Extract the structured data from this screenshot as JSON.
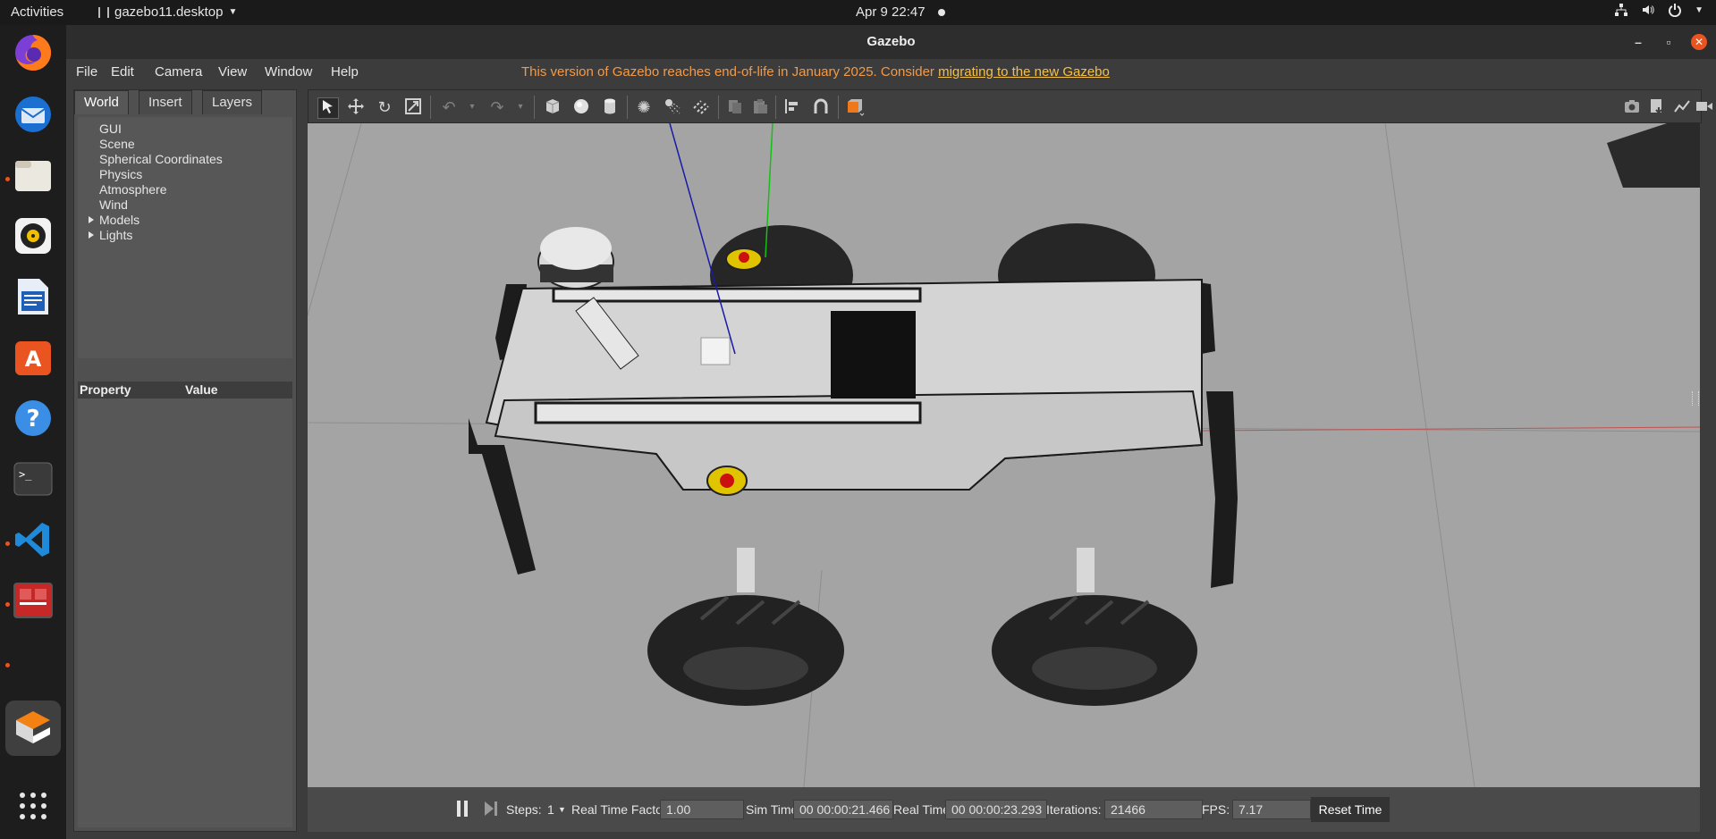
{
  "topbar": {
    "activities": "Activities",
    "app_menu": "gazebo11.desktop",
    "clock": "Apr 9  22:47"
  },
  "window": {
    "title": "Gazebo",
    "menus": [
      "File",
      "Edit",
      "Camera",
      "View",
      "Window",
      "Help"
    ],
    "notice_text": "This version of Gazebo reaches end-of-life in January 2025. Consider ",
    "notice_link": "migrating to the new Gazebo"
  },
  "left_panel": {
    "tabs": [
      "World",
      "Insert",
      "Layers"
    ],
    "active_tab": "World",
    "tree": [
      "GUI",
      "Scene",
      "Spherical Coordinates",
      "Physics",
      "Atmosphere",
      "Wind",
      "Models",
      "Lights"
    ],
    "property_header": {
      "property": "Property",
      "value": "Value"
    }
  },
  "bottom_bar": {
    "steps_label": "Steps:",
    "steps_value": "1",
    "rtf_label": "Real Time Factor:",
    "rtf_value": "1.00",
    "sim_time_label": "Sim Time:",
    "sim_time_value": "00 00:00:21.466",
    "real_time_label": "Real Time:",
    "real_time_value": "00 00:00:23.293",
    "iterations_label": "Iterations:",
    "iterations_value": "21466",
    "fps_label": "FPS:",
    "fps_value": "7.17",
    "reset_label": "Reset Time"
  },
  "colors": {
    "notice": "#f29a4a",
    "link": "#f5c04a",
    "ubuntu_orange": "#e95420",
    "viewport_bg": "#a6a6a6"
  },
  "icons": {
    "toolbar": [
      "select-icon",
      "translate-icon",
      "rotate-icon",
      "scale-icon",
      "undo-icon",
      "redo-icon",
      "box-icon",
      "sphere-icon",
      "cylinder-icon",
      "point-light-icon",
      "spot-light-icon",
      "directional-light-icon",
      "copy-icon",
      "paste-icon",
      "align-icon",
      "snap-icon",
      "view-angle-icon",
      "screenshot-icon",
      "log-icon",
      "plot-icon",
      "record-icon"
    ],
    "dock": [
      "firefox-icon",
      "thunderbird-icon",
      "files-icon",
      "rhythmbox-icon",
      "writer-icon",
      "app-center-icon",
      "help-icon",
      "terminal-icon",
      "vscode-icon",
      "app-icon",
      "gazebo-icon",
      "show-apps-icon"
    ]
  }
}
